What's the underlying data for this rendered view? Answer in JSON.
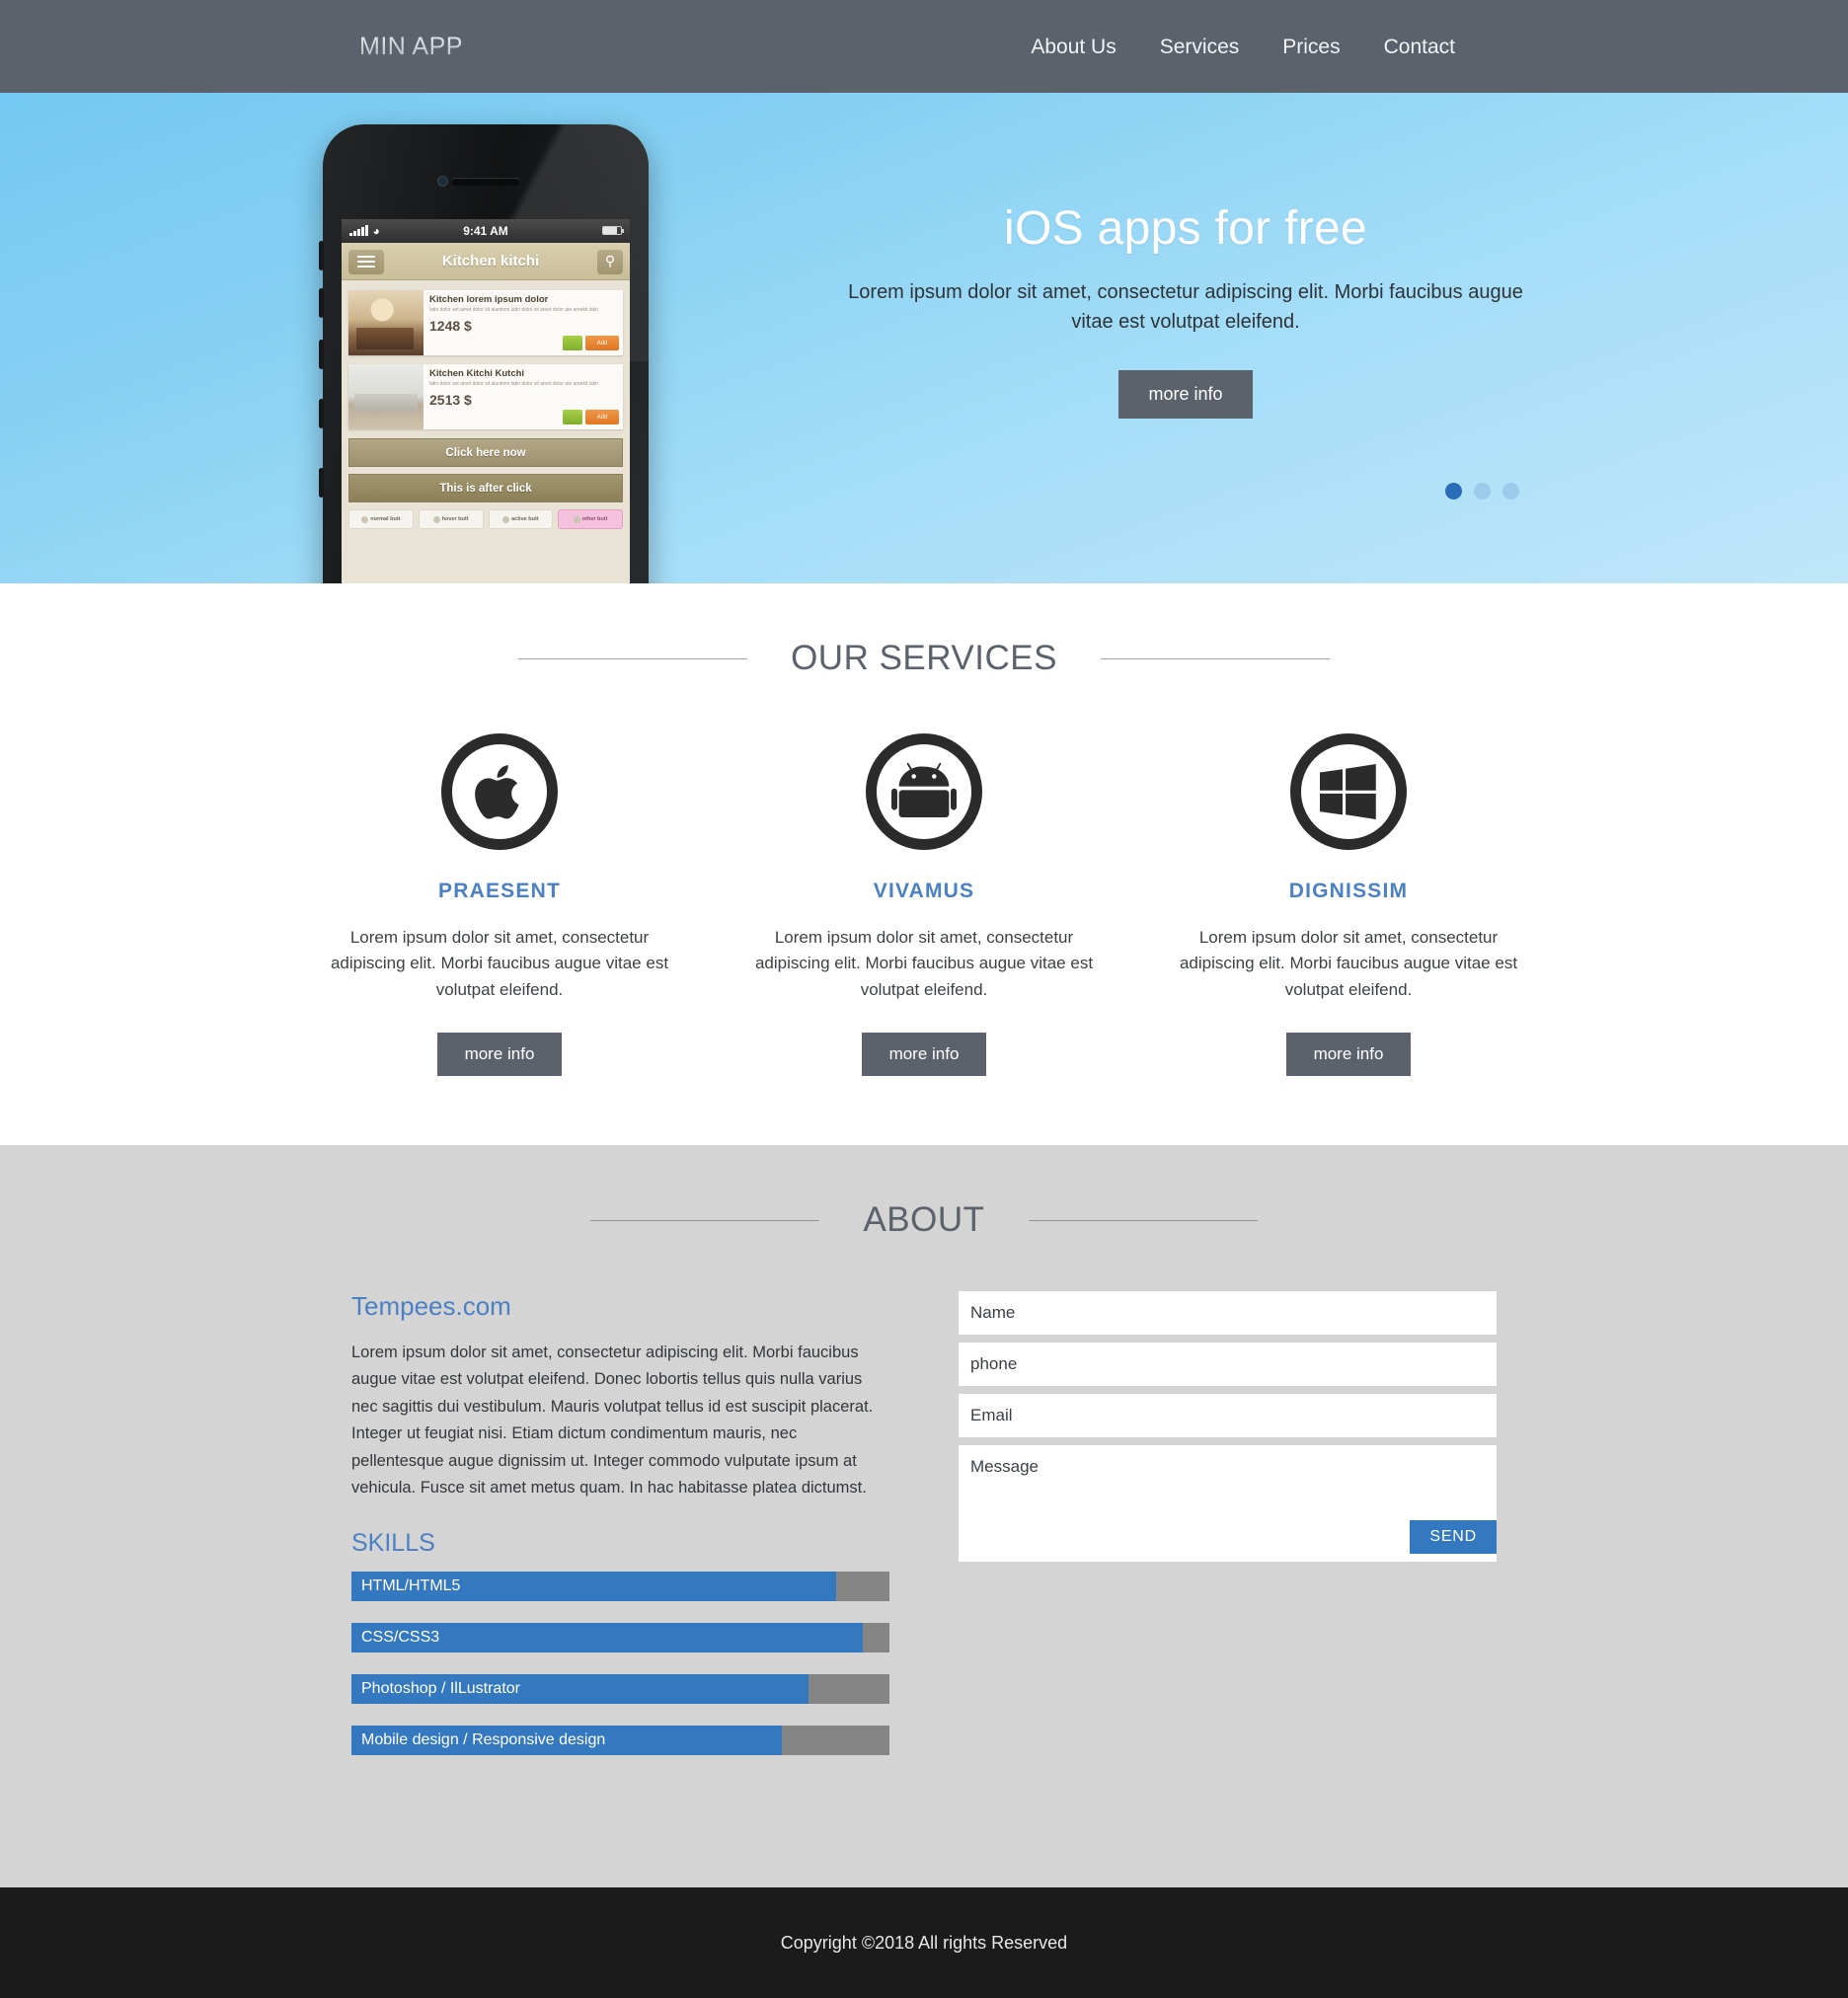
{
  "header": {
    "brand": "MIN APP",
    "nav": [
      {
        "label": "About Us"
      },
      {
        "label": "Services"
      },
      {
        "label": "Prices"
      },
      {
        "label": "Contact"
      }
    ]
  },
  "hero": {
    "title": "iOS apps for free",
    "subtitle": "Lorem ipsum dolor sit amet, consectetur adipiscing elit. Morbi faucibus augue vitae est volutpat eleifend.",
    "cta": "more info",
    "dots": 3,
    "active_dot": 0,
    "phone": {
      "status_time": "9:41 AM",
      "app_title": "Kitchen kitchi",
      "menu_icon": "hamburger-icon",
      "search_icon": "search-icon",
      "products": [
        {
          "title": "Kitchen lorem ipsum dolor",
          "desc": "latin dolor set amet dolor sit alantinm latin dolor sit amet dolor ate amekit latin",
          "price": "1248 $",
          "add_label": "Add"
        },
        {
          "title": "Kitchen Kitchi Kutchi",
          "desc": "latin dolor set amet dolor sit alantinm latin dolor sit amet dolor ate amekit latin",
          "price": "2513 $",
          "add_label": "Add"
        }
      ],
      "buttons": [
        "Click here now",
        "This is after click"
      ],
      "mini_buttons": [
        "normal butt",
        "hover butt",
        "active butt",
        "other butt"
      ]
    }
  },
  "services": {
    "heading": "OUR SERVICES",
    "items": [
      {
        "icon": "apple-icon",
        "title": "PRAESENT",
        "text": "Lorem ipsum dolor sit amet, consectetur adipiscing elit. Morbi faucibus augue vitae est volutpat eleifend.",
        "cta": "more info"
      },
      {
        "icon": "android-icon",
        "title": "VIVAMUS",
        "text": "Lorem ipsum dolor sit amet, consectetur adipiscing elit. Morbi faucibus augue vitae est volutpat eleifend.",
        "cta": "more info"
      },
      {
        "icon": "windows-icon",
        "title": "DIGNISSIM",
        "text": "Lorem ipsum dolor sit amet, consectetur adipiscing elit. Morbi faucibus augue vitae est volutpat eleifend.",
        "cta": "more info"
      }
    ]
  },
  "about": {
    "heading": "ABOUT",
    "company": "Tempees.com",
    "paragraph": "Lorem ipsum dolor sit amet, consectetur adipiscing elit. Morbi faucibus augue vitae est volutpat eleifend. Donec lobortis tellus quis nulla varius nec sagittis dui vestibulum. Mauris volutpat tellus id est suscipit placerat. Integer ut feugiat nisi. Etiam dictum condimentum mauris, nec pellentesque augue dignissim ut. Integer commodo vulputate ipsum at vehicula. Fusce sit amet metus quam. In hac habitasse platea dictumst.",
    "skills_heading": "SKILLS",
    "skills": [
      {
        "label": "HTML/HTML5",
        "percent": 90
      },
      {
        "label": "CSS/CSS3",
        "percent": 95
      },
      {
        "label": "Photoshop / IlLustrator",
        "percent": 85
      },
      {
        "label": "Mobile design / Responsive design",
        "percent": 80
      }
    ],
    "form": {
      "name_placeholder": "Name",
      "phone_placeholder": "phone",
      "email_placeholder": "Email",
      "message_placeholder": "Message",
      "send_label": "SEND"
    }
  },
  "footer": {
    "copyright": "Copyright ©2018 All rights Reserved"
  },
  "colors": {
    "header_bg": "#5b626b",
    "accent_blue": "#3478c0",
    "title_blue": "#4a80c4",
    "about_bg": "#d4d4d4",
    "footer_bg": "#1b1b1b",
    "skill_track": "#858585"
  }
}
